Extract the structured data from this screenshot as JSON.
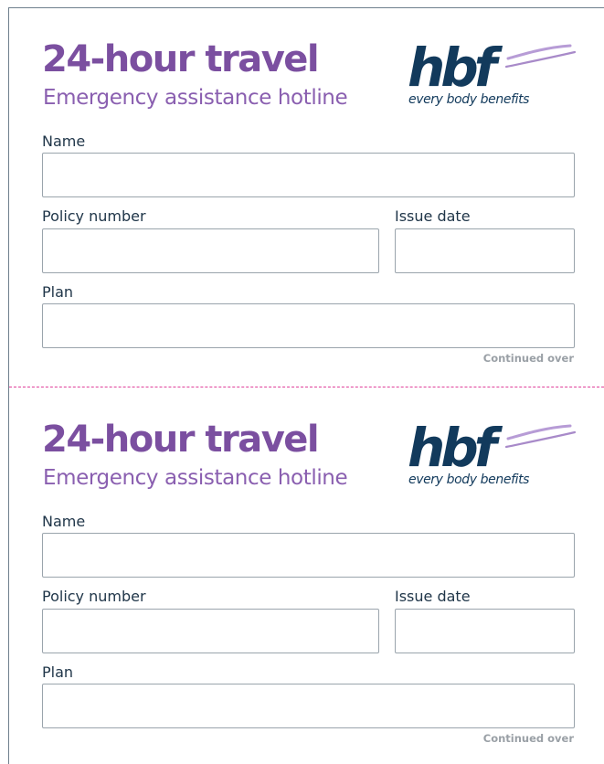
{
  "cards": [
    {
      "title": "24-hour travel",
      "subtitle": "Emergency assistance hotline",
      "logo": {
        "wordmark": "hbf",
        "tagline": "every body benefits"
      },
      "fields": {
        "name_label": "Name",
        "policy_label": "Policy number",
        "date_label": "Issue date",
        "plan_label": "Plan"
      },
      "footer": "Continued over"
    },
    {
      "title": "24-hour travel",
      "subtitle": "Emergency assistance hotline",
      "logo": {
        "wordmark": "hbf",
        "tagline": "every body benefits"
      },
      "fields": {
        "name_label": "Name",
        "policy_label": "Policy number",
        "date_label": "Issue date",
        "plan_label": "Plan"
      },
      "footer": "Continued over"
    }
  ],
  "colors": {
    "brand_purple": "#7b4fa0",
    "brand_navy": "#123a5c",
    "light_purple": "#b79cd6",
    "cut_line": "#e0409a",
    "field_border": "#9aa4ac"
  },
  "icons": {
    "logo": "hbf-logo",
    "cut_line": "dashed-cut-line"
  }
}
